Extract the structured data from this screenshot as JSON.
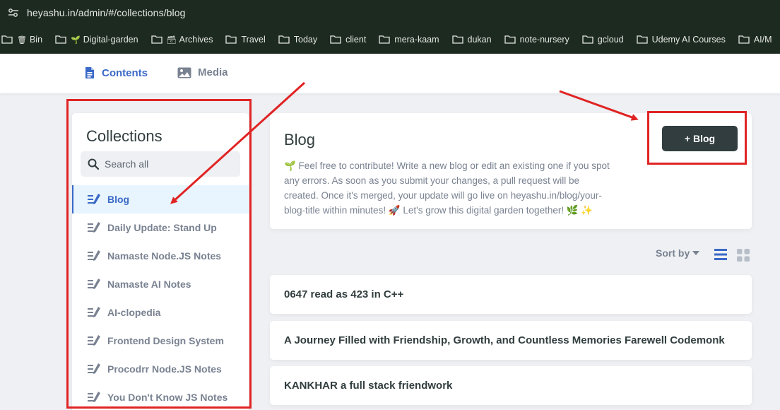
{
  "browser": {
    "url": "heyashu.in/admin/#/collections/blog",
    "bookmarks": [
      {
        "label": "Bin",
        "emoji": "🗑"
      },
      {
        "label": "Digital-garden",
        "emoji": "🌱"
      },
      {
        "label": "Archives",
        "emoji": "🗃"
      },
      {
        "label": "Travel",
        "emoji": ""
      },
      {
        "label": "Today",
        "emoji": ""
      },
      {
        "label": "client",
        "emoji": ""
      },
      {
        "label": "mera-kaam",
        "emoji": ""
      },
      {
        "label": "dukan",
        "emoji": ""
      },
      {
        "label": "note-nursery",
        "emoji": ""
      },
      {
        "label": "gcloud",
        "emoji": ""
      },
      {
        "label": "Udemy AI Courses",
        "emoji": ""
      },
      {
        "label": "AI/M",
        "emoji": ""
      }
    ]
  },
  "nav": {
    "contents_label": "Contents",
    "media_label": "Media"
  },
  "sidebar": {
    "title": "Collections",
    "search_placeholder": "Search all",
    "items": [
      {
        "label": "Blog",
        "active": true
      },
      {
        "label": "Daily Update: Stand Up",
        "active": false
      },
      {
        "label": "Namaste Node.JS Notes",
        "active": false
      },
      {
        "label": "Namaste AI Notes",
        "active": false
      },
      {
        "label": "AI-clopedia",
        "active": false
      },
      {
        "label": "Frontend Design System",
        "active": false
      },
      {
        "label": "Procodrr Node.JS Notes",
        "active": false
      },
      {
        "label": "You Don't Know JS Notes",
        "active": false
      }
    ]
  },
  "collection": {
    "title": "Blog",
    "description": "🌱 Feel free to contribute! Write a new blog or edit an existing one if you spot any errors. As soon as you submit your changes, a pull request will be created. Once it's merged, your update will go live on heyashu.in/blog/your-blog-title within minutes! 🚀 Let's grow this digital garden together! 🌿 ✨",
    "new_button_label": "+ Blog"
  },
  "controls": {
    "sort_label": "Sort by"
  },
  "entries": [
    "0647 read as 423 in C++",
    "A Journey Filled with Friendship, Growth, and Countless Memories Farewell Codemonk",
    "KANKHAR a full stack friendwork"
  ],
  "colors": {
    "accent": "#3a69c7",
    "annotation": "#e02424",
    "button_dark": "#313d3e"
  }
}
